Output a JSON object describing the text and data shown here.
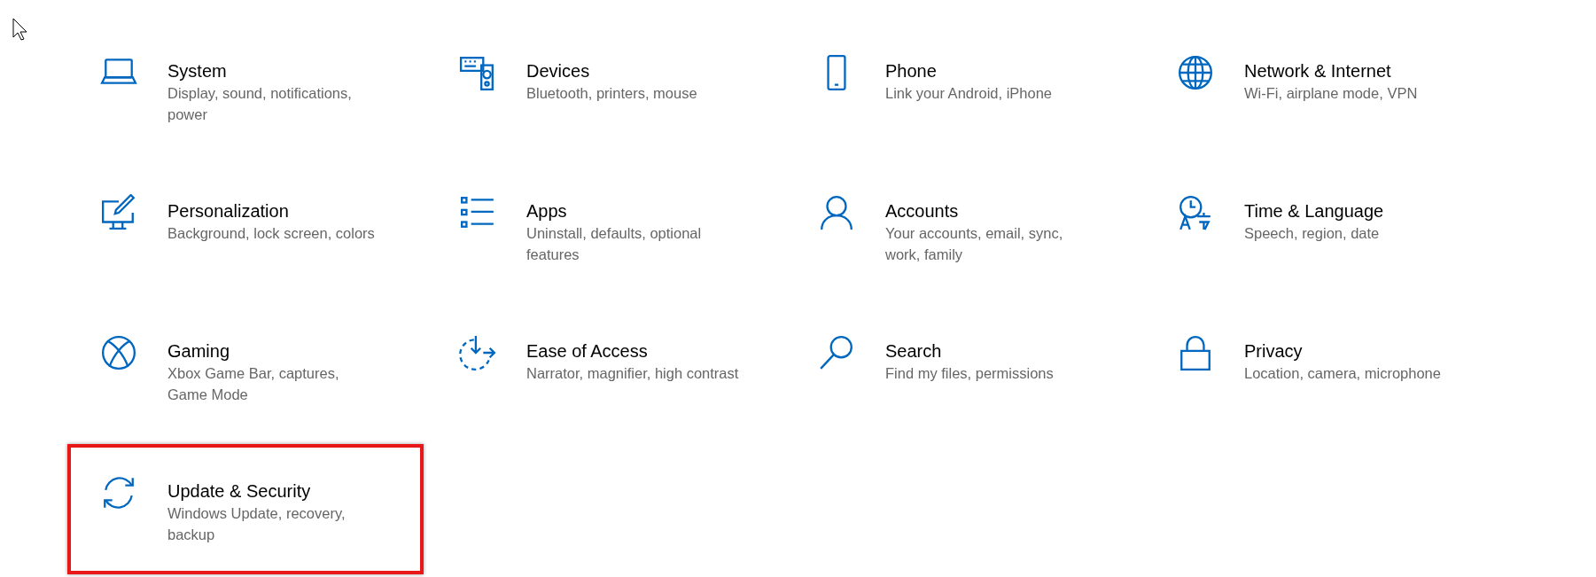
{
  "categories": [
    {
      "title": "System",
      "description": "Display, sound, notifications, power",
      "highlighted": false
    },
    {
      "title": "Devices",
      "description": "Bluetooth, printers, mouse",
      "highlighted": false
    },
    {
      "title": "Phone",
      "description": "Link your Android, iPhone",
      "highlighted": false
    },
    {
      "title": "Network & Internet",
      "description": "Wi-Fi, airplane mode, VPN",
      "highlighted": false
    },
    {
      "title": "Personalization",
      "description": "Background, lock screen, colors",
      "highlighted": false
    },
    {
      "title": "Apps",
      "description": "Uninstall, defaults, optional features",
      "highlighted": false
    },
    {
      "title": "Accounts",
      "description": "Your accounts, email, sync, work, family",
      "highlighted": false
    },
    {
      "title": "Time & Language",
      "description": "Speech, region, date",
      "highlighted": false
    },
    {
      "title": "Gaming",
      "description": "Xbox Game Bar, captures, Game Mode",
      "highlighted": false
    },
    {
      "title": "Ease of Access",
      "description": "Narrator, magnifier, high contrast",
      "highlighted": false
    },
    {
      "title": "Search",
      "description": "Find my files, permissions",
      "highlighted": false
    },
    {
      "title": "Privacy",
      "description": "Location, camera, microphone",
      "highlighted": false
    },
    {
      "title": "Update & Security",
      "description": "Windows Update, recovery, backup",
      "highlighted": true
    }
  ]
}
